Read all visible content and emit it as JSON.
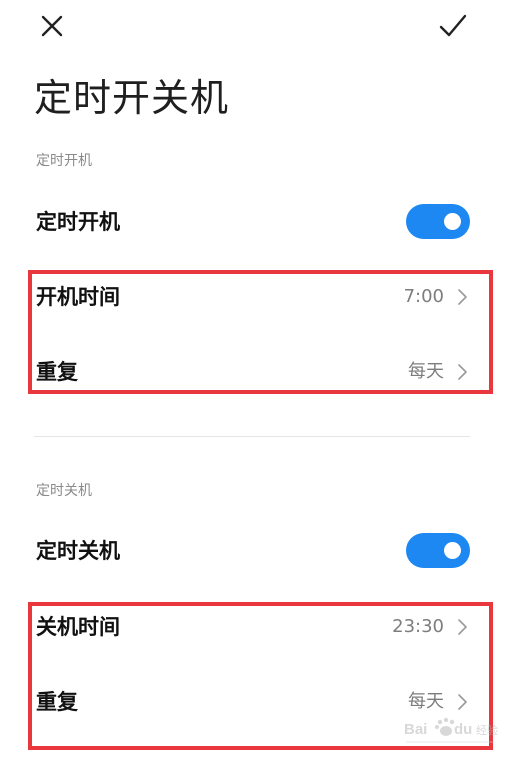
{
  "header": {
    "title": "定时开关机",
    "close_icon": "close-icon",
    "confirm_icon": "checkmark-icon"
  },
  "power_on_section": {
    "label": "定时开机",
    "toggle_label": "定时开机",
    "toggle_on": true,
    "time_label": "开机时间",
    "time_value": "7:00",
    "repeat_label": "重复",
    "repeat_value": "每天"
  },
  "power_off_section": {
    "label": "定时关机",
    "toggle_label": "定时关机",
    "toggle_on": true,
    "time_label": "关机时间",
    "time_value": "23:30",
    "repeat_label": "重复",
    "repeat_value": "每天"
  },
  "colors": {
    "toggle_on": "#1e88f2",
    "highlight_border": "#e8383d",
    "secondary_text": "#7d7d7d"
  },
  "watermark": {
    "text": "Bai du 经验"
  }
}
